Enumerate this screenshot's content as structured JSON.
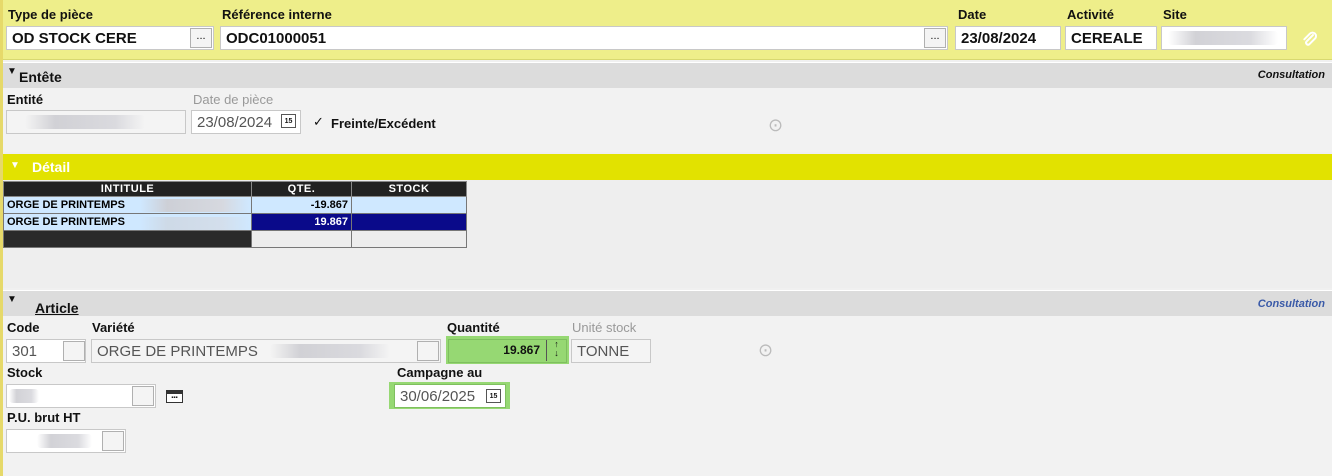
{
  "header": {
    "type_piece_label": "Type de pièce",
    "type_piece_value": "OD STOCK CERE",
    "reference_label": "Référence interne",
    "reference_value": "ODC01000051",
    "date_label": "Date",
    "date_value": "23/08/2024",
    "activite_label": "Activité",
    "activite_value": "CEREALE",
    "site_label": "Site",
    "site_value": "",
    "browse_label": "...",
    "attach_icon": "paperclip-icon"
  },
  "entete": {
    "title": "Entête",
    "mode": "Consultation",
    "entite_label": "Entité",
    "entite_value": "",
    "date_piece_label": "Date de pièce",
    "date_piece_value": "23/08/2024",
    "freinte_label": "Freinte/Excédent",
    "freinte_checked": true
  },
  "detail": {
    "title": "Détail",
    "columns": [
      "INTITULE",
      "QTE.",
      "STOCK"
    ],
    "rows": [
      {
        "intitule": "ORGE DE PRINTEMPS",
        "qte": "-19.867",
        "stock": ""
      },
      {
        "intitule": "ORGE DE PRINTEMPS",
        "qte": "19.867",
        "stock": ""
      }
    ]
  },
  "article": {
    "title": "Article",
    "mode": "Consultation",
    "code_label": "Code",
    "code_value": "301",
    "variete_label": "Variété",
    "variete_value": "ORGE DE PRINTEMPS",
    "quantite_label": "Quantité",
    "quantite_value": "19.867",
    "unite_label": "Unité stock",
    "unite_value": "TONNE",
    "stock_label": "Stock",
    "stock_value": "",
    "campagne_label": "Campagne au",
    "campagne_value": "30/06/2025",
    "pu_label": "P.U. brut HT",
    "pu_value": ""
  },
  "colors": {
    "header_bg": "#eeee8a",
    "detail_bar": "#e2e200",
    "selected_row": "#0a0a8a",
    "highlight_green": "#96d873",
    "consultation_blue": "#3a5aa8"
  }
}
